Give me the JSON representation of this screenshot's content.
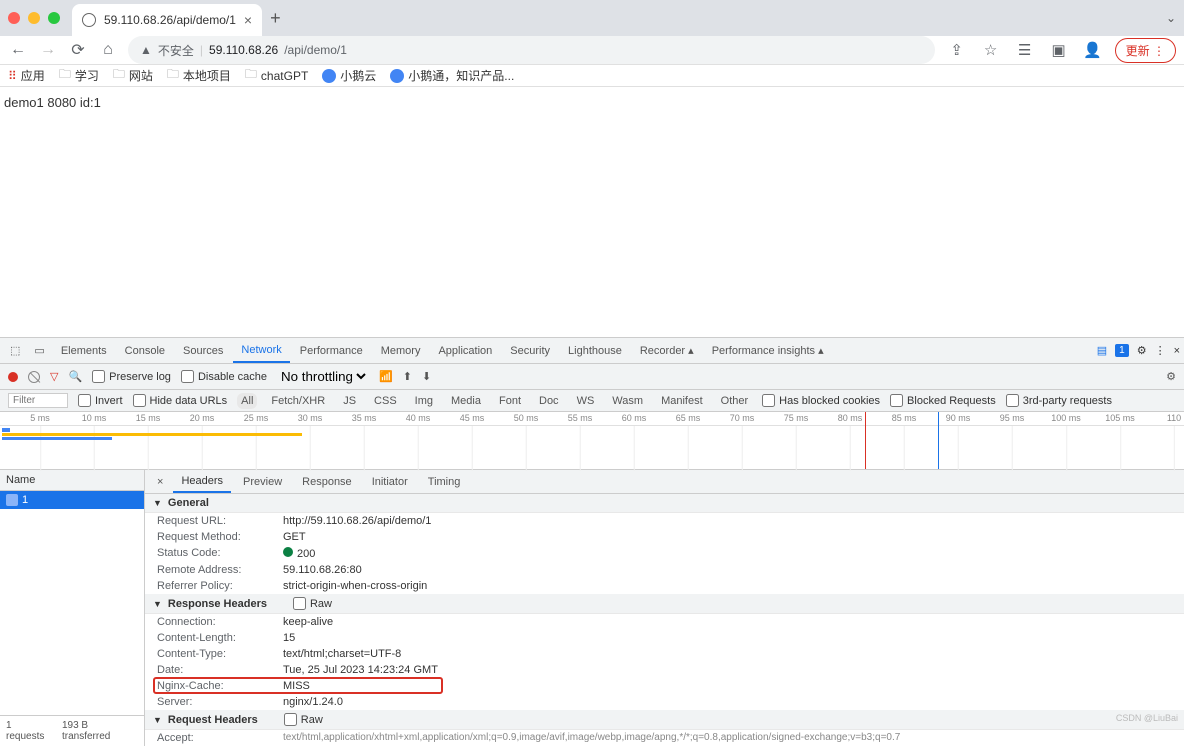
{
  "tab": {
    "title": "59.110.68.26/api/demo/1"
  },
  "address": {
    "insecure": "不安全",
    "host": "59.110.68.26",
    "path": "/api/demo/1"
  },
  "bookmarks": [
    "应用",
    "学习",
    "网站",
    "本地项目",
    "chatGPT",
    "小鹅云",
    "小鹅通，知识产品..."
  ],
  "update_btn": "更新",
  "page_text": "demo1 8080 id:1",
  "devtools_tabs": [
    "Elements",
    "Console",
    "Sources",
    "Network",
    "Performance",
    "Memory",
    "Application",
    "Security",
    "Lighthouse",
    "Recorder ▴",
    "Performance insights ▴"
  ],
  "devtools_active": "Network",
  "issues_count": "1",
  "toolbar": {
    "preserve": "Preserve log",
    "disable_cache": "Disable cache",
    "throttling": "No throttling"
  },
  "filter": {
    "placeholder": "Filter",
    "invert": "Invert",
    "hide_data": "Hide data URLs",
    "types": [
      "All",
      "Fetch/XHR",
      "JS",
      "CSS",
      "Img",
      "Media",
      "Font",
      "Doc",
      "WS",
      "Wasm",
      "Manifest",
      "Other"
    ],
    "has_blocked": "Has blocked cookies",
    "blocked_req": "Blocked Requests",
    "third_party": "3rd-party requests"
  },
  "timeline_ticks": [
    "5 ms",
    "10 ms",
    "15 ms",
    "20 ms",
    "25 ms",
    "30 ms",
    "35 ms",
    "40 ms",
    "45 ms",
    "50 ms",
    "55 ms",
    "60 ms",
    "65 ms",
    "70 ms",
    "75 ms",
    "80 ms",
    "85 ms",
    "90 ms",
    "95 ms",
    "100 ms",
    "105 ms",
    "110"
  ],
  "req_list": {
    "header": "Name",
    "rows": [
      "1"
    ]
  },
  "status_bar": {
    "requests": "1 requests",
    "transferred": "193 B transferred"
  },
  "detail_tabs": [
    "Headers",
    "Preview",
    "Response",
    "Initiator",
    "Timing"
  ],
  "detail_active": "Headers",
  "sections": {
    "general": "General",
    "response": "Response Headers",
    "request": "Request Headers",
    "raw": "Raw"
  },
  "general": {
    "url_k": "Request URL:",
    "url_v": "http://59.110.68.26/api/demo/1",
    "method_k": "Request Method:",
    "method_v": "GET",
    "status_k": "Status Code:",
    "status_v": "200",
    "remote_k": "Remote Address:",
    "remote_v": "59.110.68.26:80",
    "referrer_k": "Referrer Policy:",
    "referrer_v": "strict-origin-when-cross-origin"
  },
  "response_headers": {
    "conn_k": "Connection:",
    "conn_v": "keep-alive",
    "len_k": "Content-Length:",
    "len_v": "15",
    "type_k": "Content-Type:",
    "type_v": "text/html;charset=UTF-8",
    "date_k": "Date:",
    "date_v": "Tue, 25 Jul 2023 14:23:24 GMT",
    "cache_k": "Nginx-Cache:",
    "cache_v": "MISS",
    "server_k": "Server:",
    "server_v": "nginx/1.24.0"
  },
  "request_headers": {
    "accept_k": "Accept:",
    "accept_v": "text/html,application/xhtml+xml,application/xml;q=0.9,image/avif,image/webp,image/apng,*/*;q=0.8,application/signed-exchange;v=b3;q=0.7"
  },
  "watermark": "CSDN @LiuBai"
}
